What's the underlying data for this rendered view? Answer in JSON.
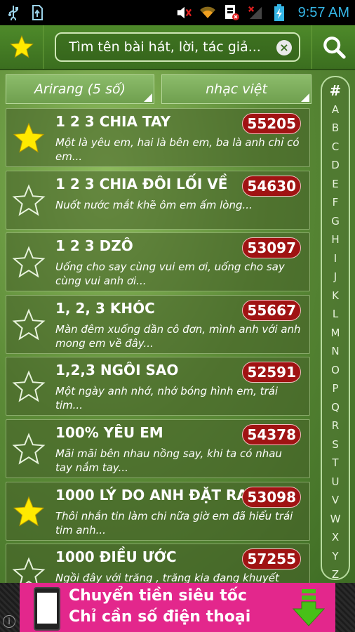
{
  "status_bar": {
    "time": "9:57 AM",
    "icons": [
      "usb-icon",
      "sd-card-icon",
      "mute-icon",
      "wifi-icon",
      "sim-icon",
      "no-signal-icon",
      "battery-charging-icon"
    ]
  },
  "toolbar": {
    "search_placeholder": "Tìm tên bài hát, lời, tác giả...",
    "clear_label": "×"
  },
  "filters": {
    "source": "Arirang (5 số)",
    "genre": "nhạc việt"
  },
  "songs": [
    {
      "title": "1 2 3 CHIA TAY",
      "code": "55205",
      "lyric": "Một là yêu em, hai là bên em, ba là anh chỉ có em...",
      "favorite": true
    },
    {
      "title": "1 2 3 CHIA ĐÔI LỐI VỀ",
      "code": "54630",
      "lyric": "Nuốt nước mắt khẽ ôm em ấm lòng...",
      "favorite": false
    },
    {
      "title": "1 2 3 DZÔ",
      "code": "53097",
      "lyric": "Uống cho say cùng vui em ơi, uống cho say cùng vui anh ơi...",
      "favorite": false
    },
    {
      "title": "1, 2, 3 KHÓC",
      "code": "55667",
      "lyric": "Màn đêm xuống dần cô đơn, mình anh với anh mong em về đây...",
      "favorite": false
    },
    {
      "title": "1,2,3 NGÔI SAO",
      "code": "52591",
      "lyric": "Một ngày anh nhớ, nhớ bóng hình em, trái tim...",
      "favorite": false
    },
    {
      "title": "100% YÊU EM",
      "code": "54378",
      "lyric": "Mãi mãi bên nhau nồng say, khi ta có nhau tay nắm tay...",
      "favorite": false
    },
    {
      "title": "1000 LÝ DO ANH ĐẶT RA",
      "code": "53098",
      "lyric": "Thôi nhắn tin làm chi nữa giờ em đã hiểu trái tim anh...",
      "favorite": true
    },
    {
      "title": "1000 ĐIỀU ƯỚC",
      "code": "57255",
      "lyric": "Ngồi đây với trăng , trăng kia đang khuyết",
      "favorite": false
    }
  ],
  "alphabet": [
    "#",
    "A",
    "B",
    "C",
    "D",
    "E",
    "F",
    "G",
    "H",
    "I",
    "J",
    "K",
    "L",
    "M",
    "N",
    "O",
    "P",
    "Q",
    "R",
    "S",
    "T",
    "U",
    "V",
    "W",
    "X",
    "Y",
    "Z"
  ],
  "ad": {
    "line1": "Chuyển tiền siêu tốc",
    "line2": "Chỉ cần số điện thoại",
    "info": "i"
  },
  "colors": {
    "accent_green": "#4e8a2a",
    "code_badge": "#a01313",
    "star_fill": "#ffea00",
    "ad_pink": "#e3278c",
    "status_blue": "#35b5e5"
  }
}
